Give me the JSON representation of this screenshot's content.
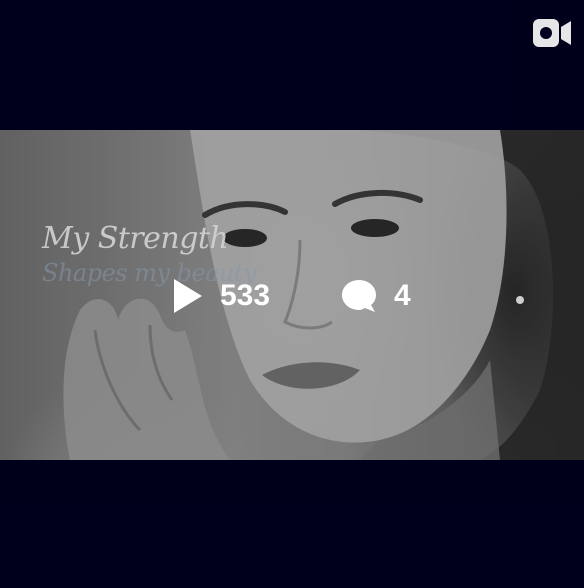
{
  "post": {
    "media_type_icon": "video-camera-icon",
    "background_color": "#01001f",
    "frame": {
      "caption_line1": "My Strength",
      "caption_line2": "Shapes my beauty"
    },
    "stats": {
      "plays": {
        "icon": "play-icon",
        "count": "533"
      },
      "comments": {
        "icon": "comment-bubble-icon",
        "count": "4"
      }
    }
  }
}
